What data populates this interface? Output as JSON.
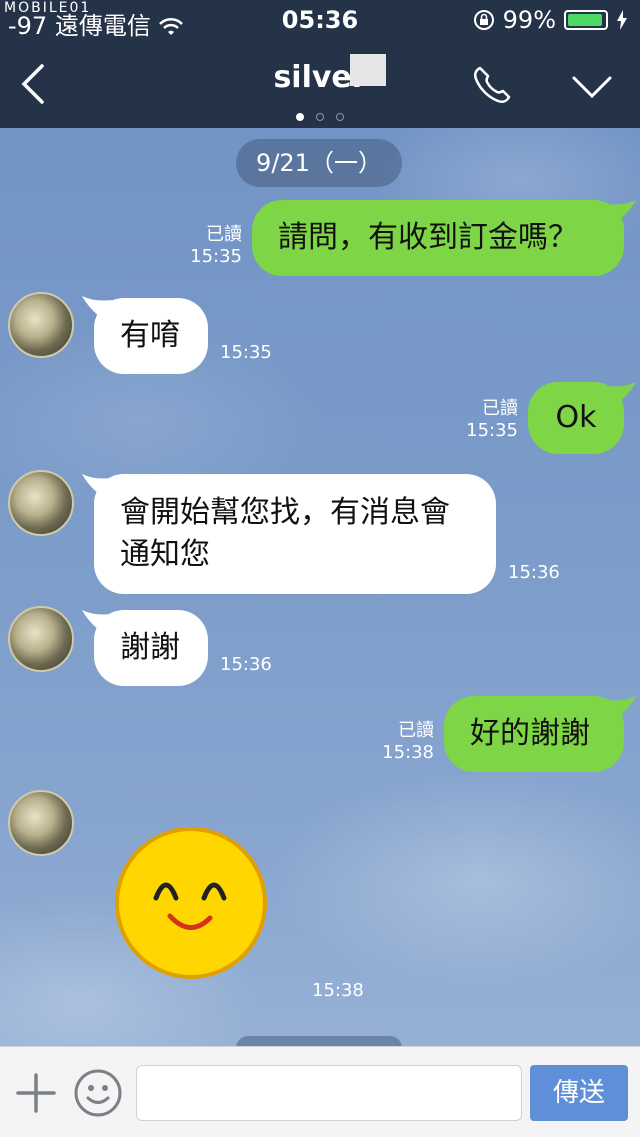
{
  "status_bar": {
    "carrier": "-97 遠傳電信",
    "time": "05:36",
    "battery_percent": "99%",
    "watermark": "MOBILE01"
  },
  "header": {
    "title": "silver",
    "page_dots": [
      true,
      false,
      false
    ]
  },
  "date_separator": "9/21（一）",
  "messages": [
    {
      "side": "out",
      "text": "請問，有收到訂金嗎？",
      "read": "已讀",
      "time": "15:35"
    },
    {
      "side": "in",
      "text": "有唷",
      "time": "15:35"
    },
    {
      "side": "out",
      "text": "Ok",
      "read": "已讀",
      "time": "15:35"
    },
    {
      "side": "in",
      "text_lines": [
        "會開始幫您找，有消息會",
        "通知您"
      ],
      "time": "15:36"
    },
    {
      "side": "in",
      "text": "謝謝",
      "time": "15:36"
    },
    {
      "side": "out",
      "text": "好的謝謝",
      "read": "已讀",
      "time": "15:38"
    },
    {
      "side": "in",
      "sticker": "smiley-face-sticker",
      "time": "15:38"
    }
  ],
  "input_bar": {
    "placeholder": "",
    "send_label": "傳送"
  },
  "colors": {
    "header_bg": "#253349",
    "outgoing_bubble": "#7ed647",
    "incoming_bubble": "#ffffff",
    "send_button": "#5f8fd9"
  }
}
